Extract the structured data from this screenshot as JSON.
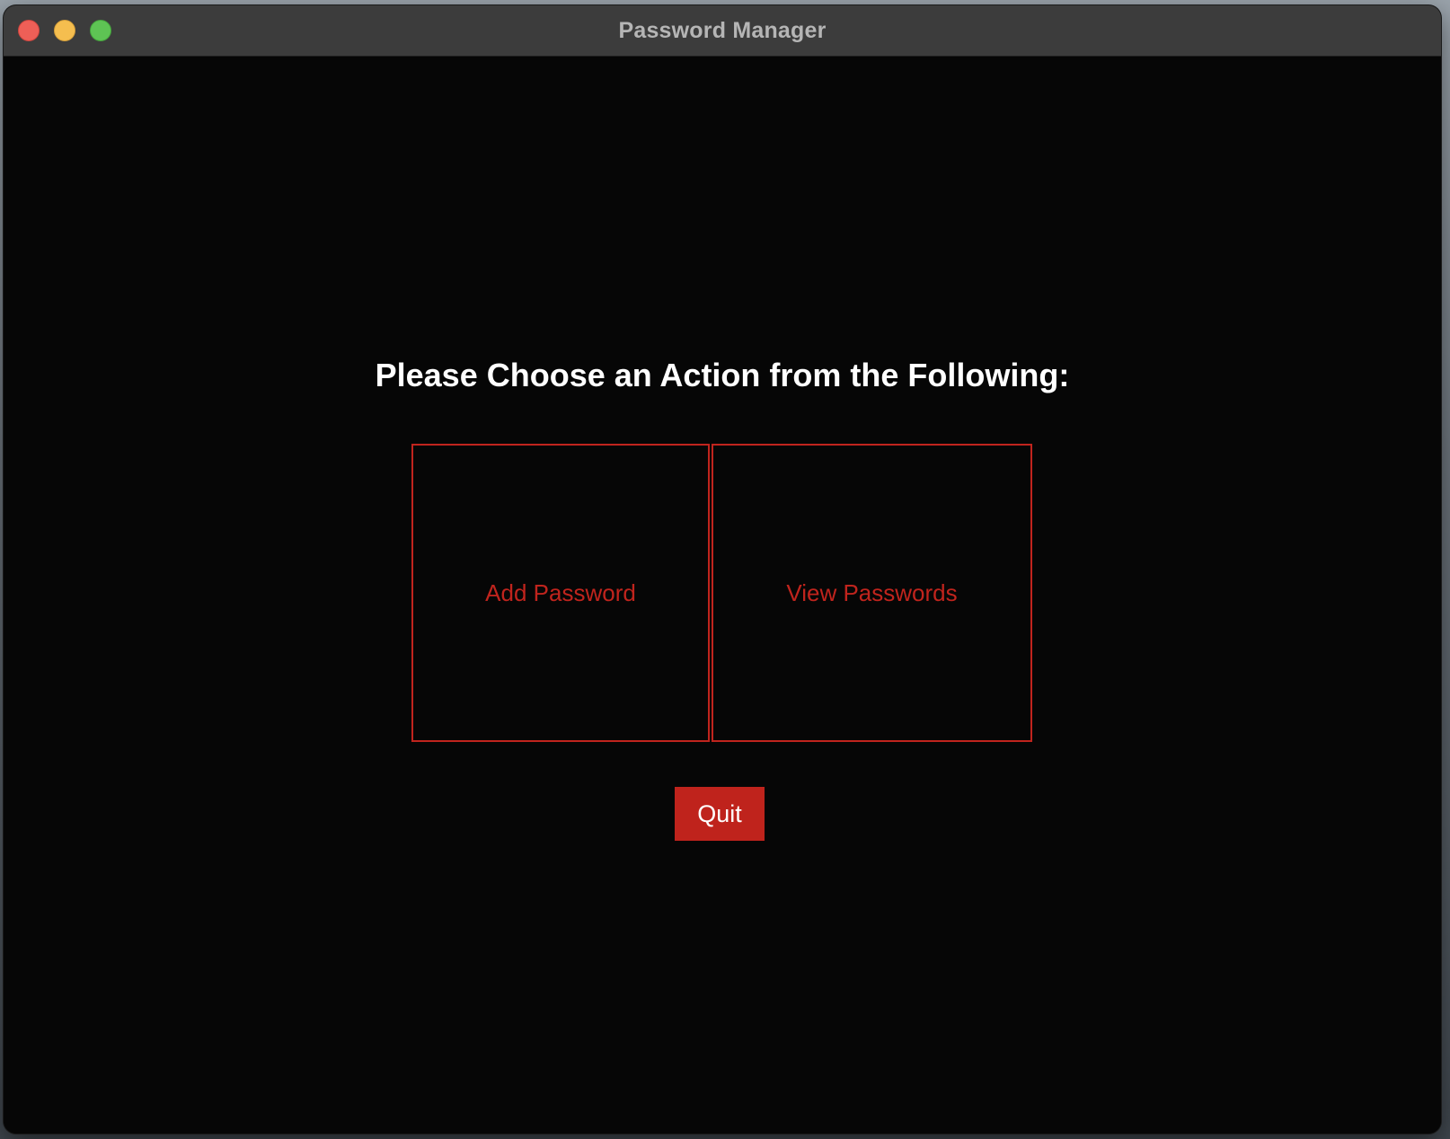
{
  "window": {
    "title": "Password Manager"
  },
  "main": {
    "prompt": "Please Choose an Action from the Following:",
    "actions": [
      {
        "label": "Add Password"
      },
      {
        "label": "View Passwords"
      }
    ],
    "quit_label": "Quit"
  },
  "colors": {
    "accent": "#c0241d",
    "background": "#060606",
    "titlebar": "#3c3c3c"
  }
}
